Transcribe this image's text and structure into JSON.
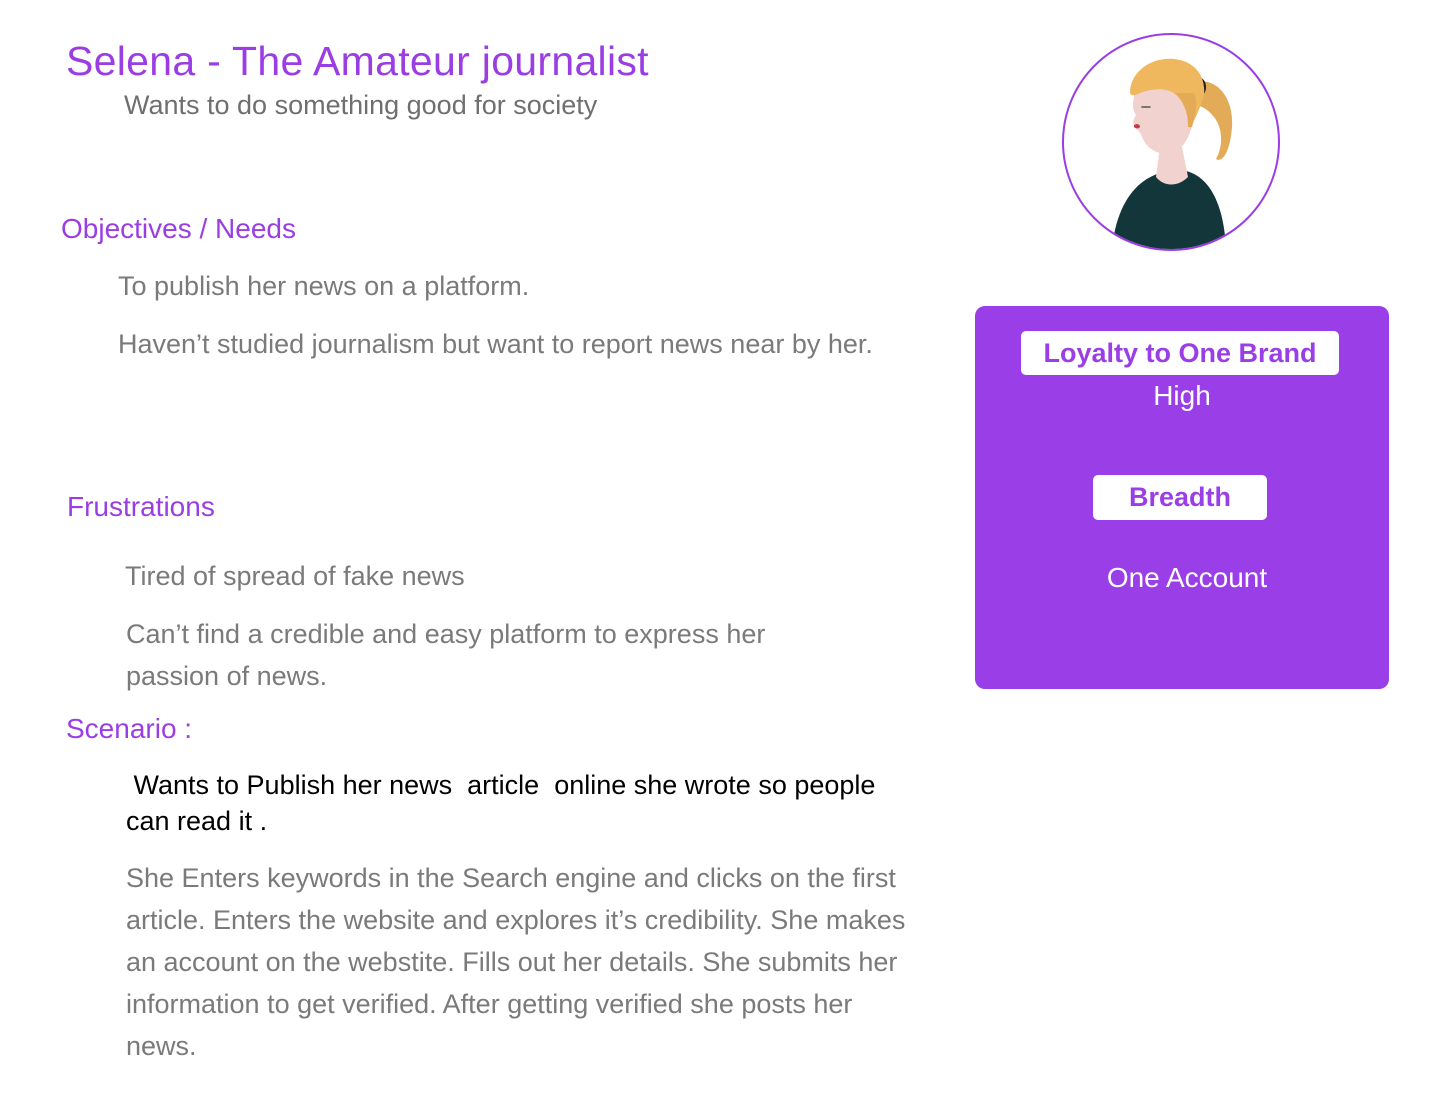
{
  "header": {
    "title": "Selena - The Amateur journalist",
    "subtitle": "Wants to do something good for society"
  },
  "objectives": {
    "heading": "Objectives / Needs",
    "items": [
      "To publish her news on a platform.",
      "Haven’t studied journalism but want to report news near by her."
    ]
  },
  "frustrations": {
    "heading": "Frustrations",
    "items": [
      "Tired of spread of fake news",
      "Can’t find a credible and easy platform to express her passion of news."
    ]
  },
  "scenario": {
    "heading": "Scenario :",
    "lead": " Wants to Publish her news  article  online she wrote so people can read it .",
    "body": "She Enters keywords in the Search engine and clicks on the first article. Enters the website and explores it’s credibility. She makes an account on the webstite. Fills out her details. She submits her information to get verified. After getting verified she posts her news."
  },
  "metrics": {
    "loyalty_label": "Loyalty to One Brand",
    "loyalty_value": "High",
    "breadth_label": "Breadth",
    "breadth_value": "One Account"
  },
  "colors": {
    "accent": "#9a3ee3",
    "card": "#9a3ee8",
    "body_text": "#7a7a7a"
  },
  "icons": {
    "avatar": "woman-profile-illustration"
  }
}
